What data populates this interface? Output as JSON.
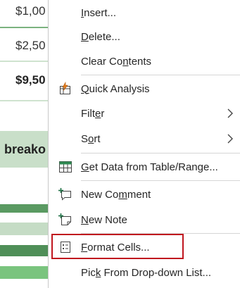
{
  "sheet": {
    "cells": [
      "$1,00",
      "$2,50",
      "$9,50",
      "breako"
    ]
  },
  "menu": {
    "items": [
      {
        "before": "",
        "key": "I",
        "after": "nsert...",
        "icon": "none"
      },
      {
        "before": "",
        "key": "D",
        "after": "elete...",
        "icon": "none"
      },
      {
        "before": "Clear Co",
        "key": "n",
        "after": "tents",
        "icon": "none"
      },
      {
        "before": "",
        "key": "Q",
        "after": "uick Analysis",
        "icon": "quick-analysis-icon"
      },
      {
        "before": "Filt",
        "key": "e",
        "after": "r",
        "icon": "none",
        "submenu": true
      },
      {
        "before": "S",
        "key": "o",
        "after": "rt",
        "icon": "none",
        "submenu": true
      },
      {
        "before": "",
        "key": "G",
        "after": "et Data from Table/Range...",
        "icon": "table-icon"
      },
      {
        "before": "New Co",
        "key": "m",
        "after": "ment",
        "icon": "new-comment-icon"
      },
      {
        "before": "",
        "key": "N",
        "after": "ew Note",
        "icon": "new-note-icon"
      },
      {
        "before": "",
        "key": "F",
        "after": "ormat Cells...",
        "icon": "format-cells-icon",
        "highlighted": true
      },
      {
        "before": "Pic",
        "key": "k",
        "after": " From Drop-down List...",
        "icon": "none"
      }
    ]
  },
  "colors": {
    "highlight_border": "#c0161e",
    "icon_green": "#1e7145",
    "icon_orange": "#e07a1b"
  }
}
